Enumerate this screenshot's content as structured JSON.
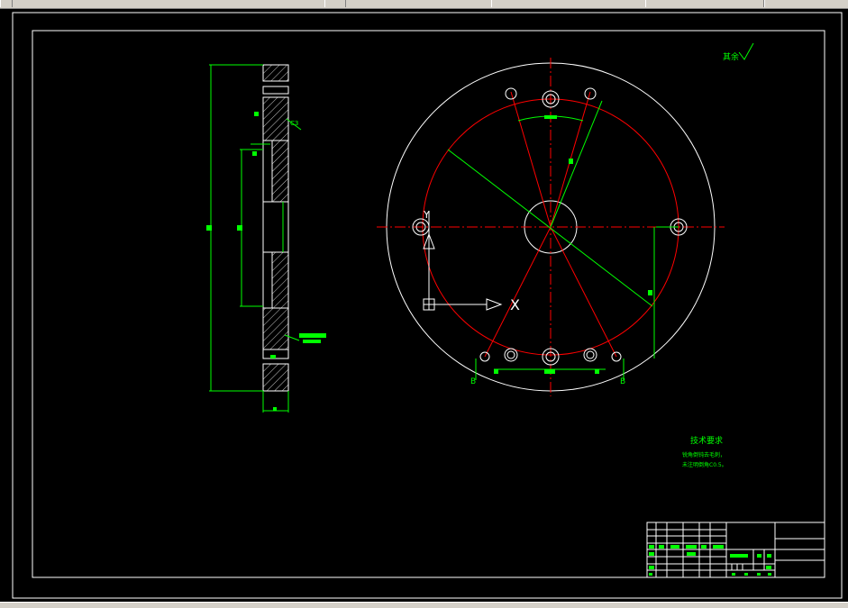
{
  "app": {
    "toolbar_buttons": [
      "",
      "",
      "",
      "",
      ""
    ]
  },
  "drawing": {
    "rough_mark": "其余",
    "tech_title": "技术要求",
    "tech_line1": "锐角倒钝去毛刺，",
    "tech_line2": "未注明倒角C0.5。",
    "ucs_x": "X",
    "ucs_y": "Y",
    "section_label_left": "B",
    "section_label_right": "B",
    "chamfer_label": "C3",
    "colors": {
      "background": "#000000",
      "frame": "#ffffff",
      "dimension": "#00ff00",
      "centerline": "#ff0000",
      "hatch": "#ffffff",
      "titleblock": "#ffffff"
    }
  }
}
